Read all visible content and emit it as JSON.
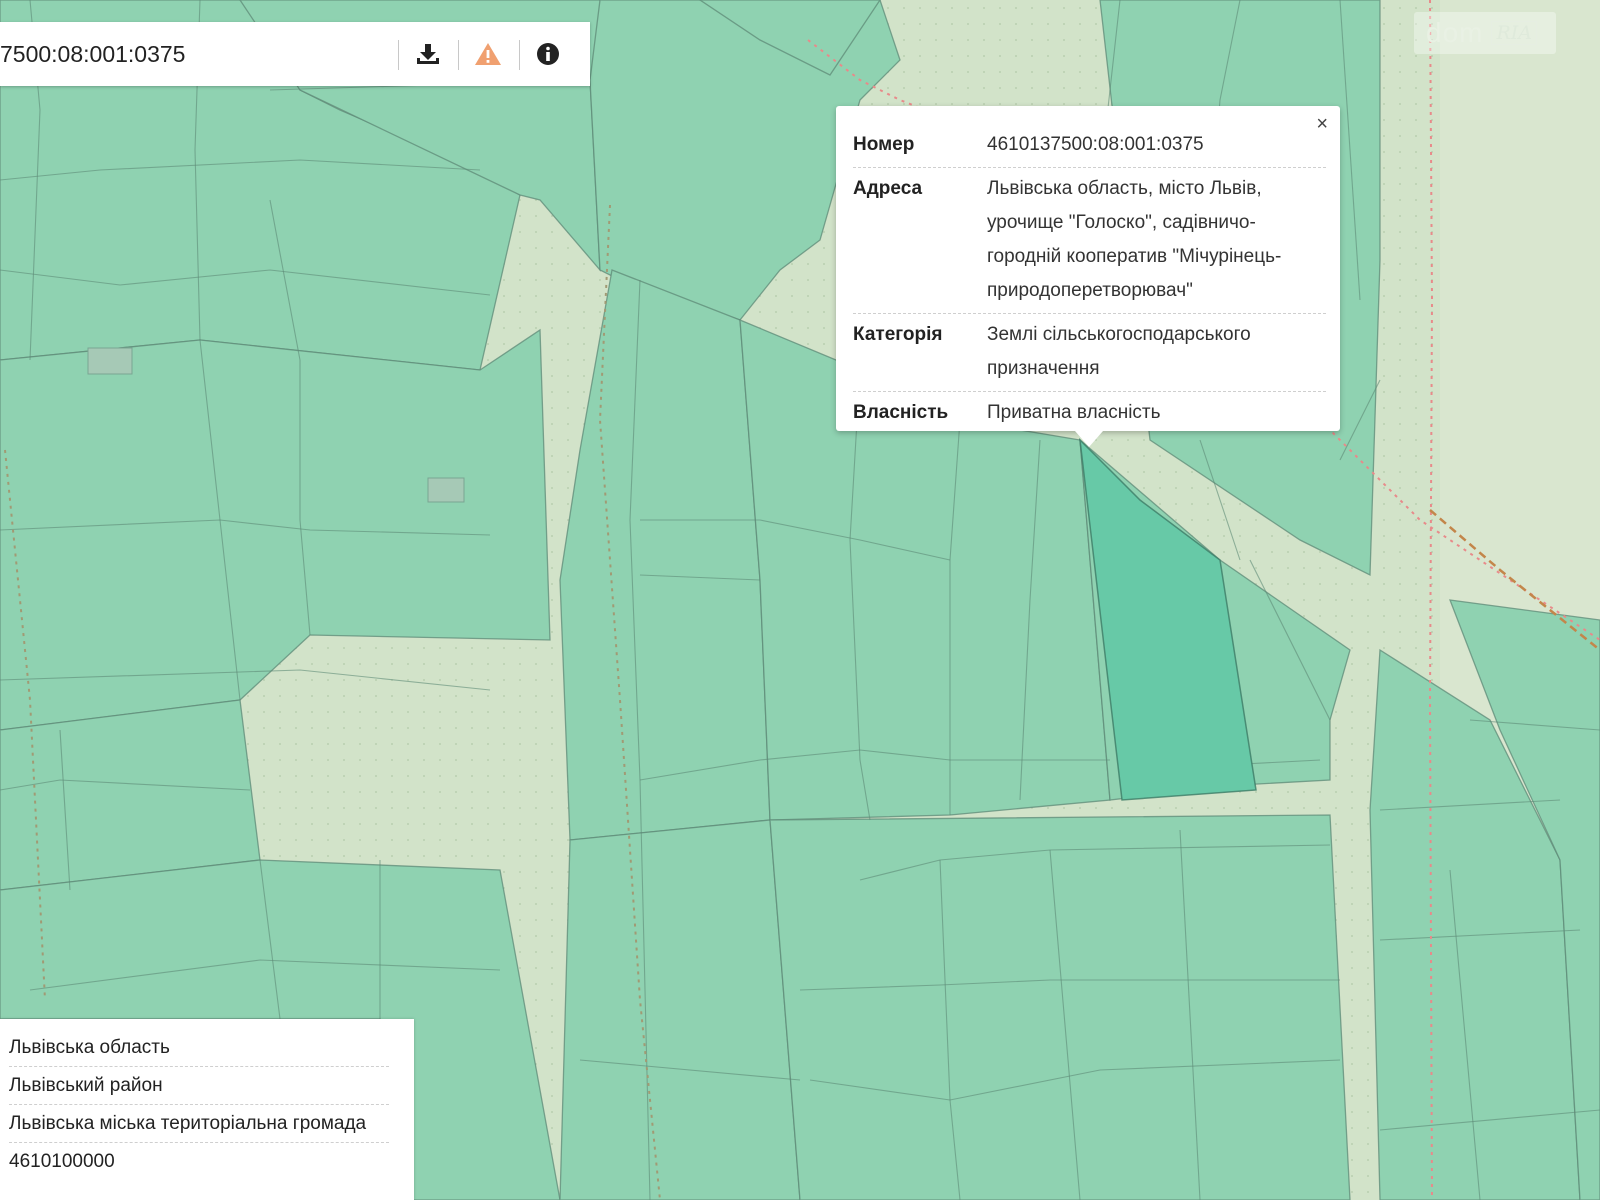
{
  "toolbar": {
    "cadastral_number_partial": "7500:08:001:0375",
    "buttons": [
      {
        "name": "download-icon",
        "color": "#222222"
      },
      {
        "name": "warning-icon",
        "color": "#f0a070"
      },
      {
        "name": "info-icon",
        "color": "#222222"
      }
    ]
  },
  "logo": {
    "part1": "dom",
    "part2": "RIA"
  },
  "popup": {
    "close": "×",
    "rows": [
      {
        "key": "Номер",
        "value": "4610137500:08:001:0375"
      },
      {
        "key": "Адреса",
        "value": "Львівська область, місто Львів, урочище \"Голоско\", садівничо-городній кооператив \"Мічурінець-природоперетворювач\""
      },
      {
        "key": "Категорія",
        "value": "Землі сільськогосподарського призначення"
      },
      {
        "key": "Власність",
        "value": "Приватна власність"
      }
    ]
  },
  "admin_info": {
    "rows": [
      "Львівська область",
      "Львівський район",
      "Львівська міська територіальна громада",
      "4610100000"
    ]
  },
  "colors": {
    "parcel": "#8fd2b1",
    "selected_parcel": "#67c9a7",
    "background": "#d2e3c9",
    "boundary": "#e88a8a"
  }
}
